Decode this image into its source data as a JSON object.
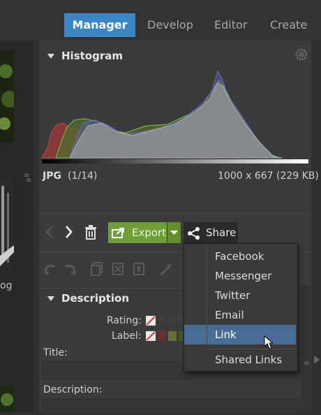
{
  "nav": {
    "tabs": [
      "Manager",
      "Develop",
      "Editor",
      "Create"
    ],
    "active": "Manager"
  },
  "histogram": {
    "title": "Histogram",
    "file_type": "JPG",
    "file_index": "(1/14)",
    "dimensions": "1000 x 667 (229 KB)"
  },
  "toolbar": {
    "export_label": "Export",
    "share_label": "Share"
  },
  "share_menu": {
    "items": [
      "Facebook",
      "Messenger",
      "Twitter",
      "Email",
      "Link"
    ],
    "extra": "Shared Links",
    "selected": "Link"
  },
  "description_section": {
    "title": "Description",
    "rating_label": "Rating:",
    "label_label": "Label:",
    "title_field_label": "Title:",
    "description_field_label": "Description:"
  },
  "left_strip": {
    "caption_fragment": "og"
  },
  "colors": {
    "accent": "#3d86c6",
    "export_green": "#6f9e38",
    "menu_highlight": "#4a6d97"
  }
}
